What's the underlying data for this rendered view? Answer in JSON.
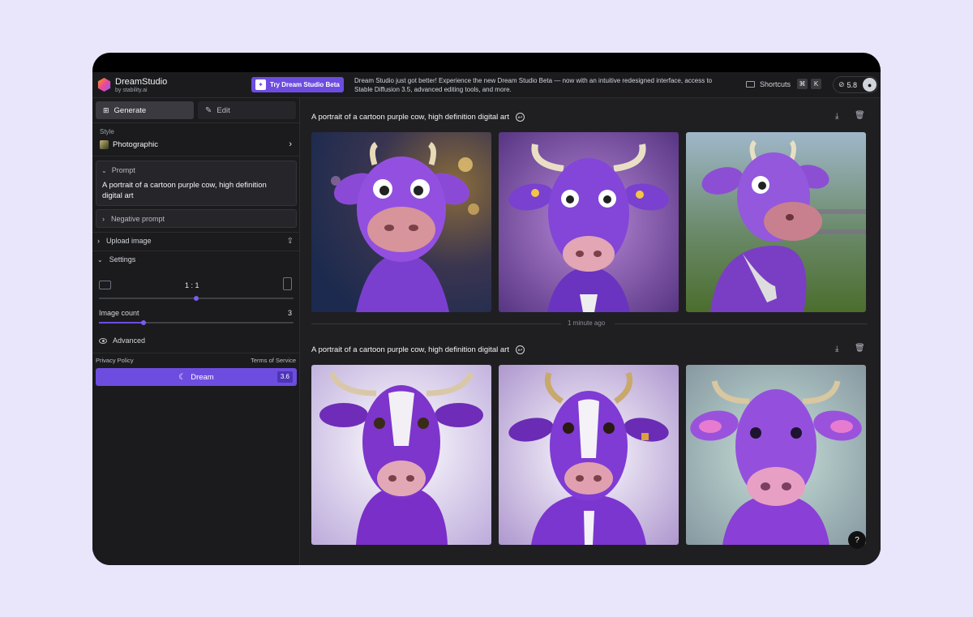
{
  "header": {
    "app_name": "DreamStudio",
    "app_sub": "by stability.ai",
    "beta_button": "Try Dream Studio Beta",
    "announcement": "Dream Studio just got better! Experience the new Dream Studio Beta — now with an intuitive redesigned interface, access to Stable Diffusion 3.5, advanced editing tools, and more.",
    "shortcuts_label": "Shortcuts",
    "shortcut_keys": [
      "⌘",
      "K"
    ],
    "credits": "5.8"
  },
  "sidebar": {
    "tabs": [
      {
        "label": "Generate",
        "icon": "grid-icon",
        "active": true
      },
      {
        "label": "Edit",
        "icon": "edit-icon",
        "active": false
      }
    ],
    "style_label": "Style",
    "style_value": "Photographic",
    "prompt_label": "Prompt",
    "prompt_text": "A portrait of a cartoon purple cow, high definition digital art",
    "negative_prompt_label": "Negative prompt",
    "upload_label": "Upload image",
    "settings_label": "Settings",
    "aspect_ratio": "1 : 1",
    "aspect_slider_fraction": 0.5,
    "image_count_label": "Image count",
    "image_count": "3",
    "image_count_fraction": 0.23,
    "advanced_label": "Advanced",
    "privacy_link": "Privacy Policy",
    "terms_link": "Terms of Service",
    "dream_button": "Dream",
    "dream_cost": "3.6"
  },
  "main": {
    "generations": [
      {
        "prompt": "A portrait of a cartoon purple cow, high definition digital art",
        "images": 3
      },
      {
        "prompt": "A portrait of a cartoon purple cow, high definition digital art",
        "images": 3
      }
    ],
    "separator_time": "1 minute ago",
    "help_label": "?"
  },
  "colors": {
    "accent": "#6d4de0",
    "background": "#1f1f22",
    "sidebar": "#1b1b1e",
    "page": "#e9e6fb"
  }
}
